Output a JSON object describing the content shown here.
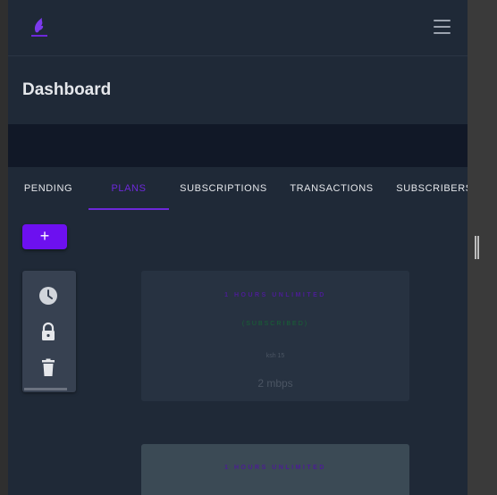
{
  "header": {
    "title": "Dashboard"
  },
  "tabs": [
    {
      "label": "PENDING",
      "active": false
    },
    {
      "label": "PLANS",
      "active": true
    },
    {
      "label": "SUBSCRIPTIONS",
      "active": false
    },
    {
      "label": "TRANSACTIONS",
      "active": false
    },
    {
      "label": "SUBSCRIBERS",
      "active": false
    }
  ],
  "toolbar": {
    "add_label": "+"
  },
  "side_actions": [
    "clock-icon",
    "lock-icon",
    "trash-icon"
  ],
  "plans": [
    {
      "name": "1 HOURS UNLIMITED",
      "status": "(SUBSCRIBED)",
      "price": "ksh 15",
      "speed": "2 mbps"
    },
    {
      "name": "1 HOURS UNLIMITED"
    }
  ],
  "colors": {
    "accent": "#6d28d9",
    "button": "#6d10f0",
    "background": "#1f2937",
    "banner": "#111827",
    "subscribed": "#166534"
  }
}
